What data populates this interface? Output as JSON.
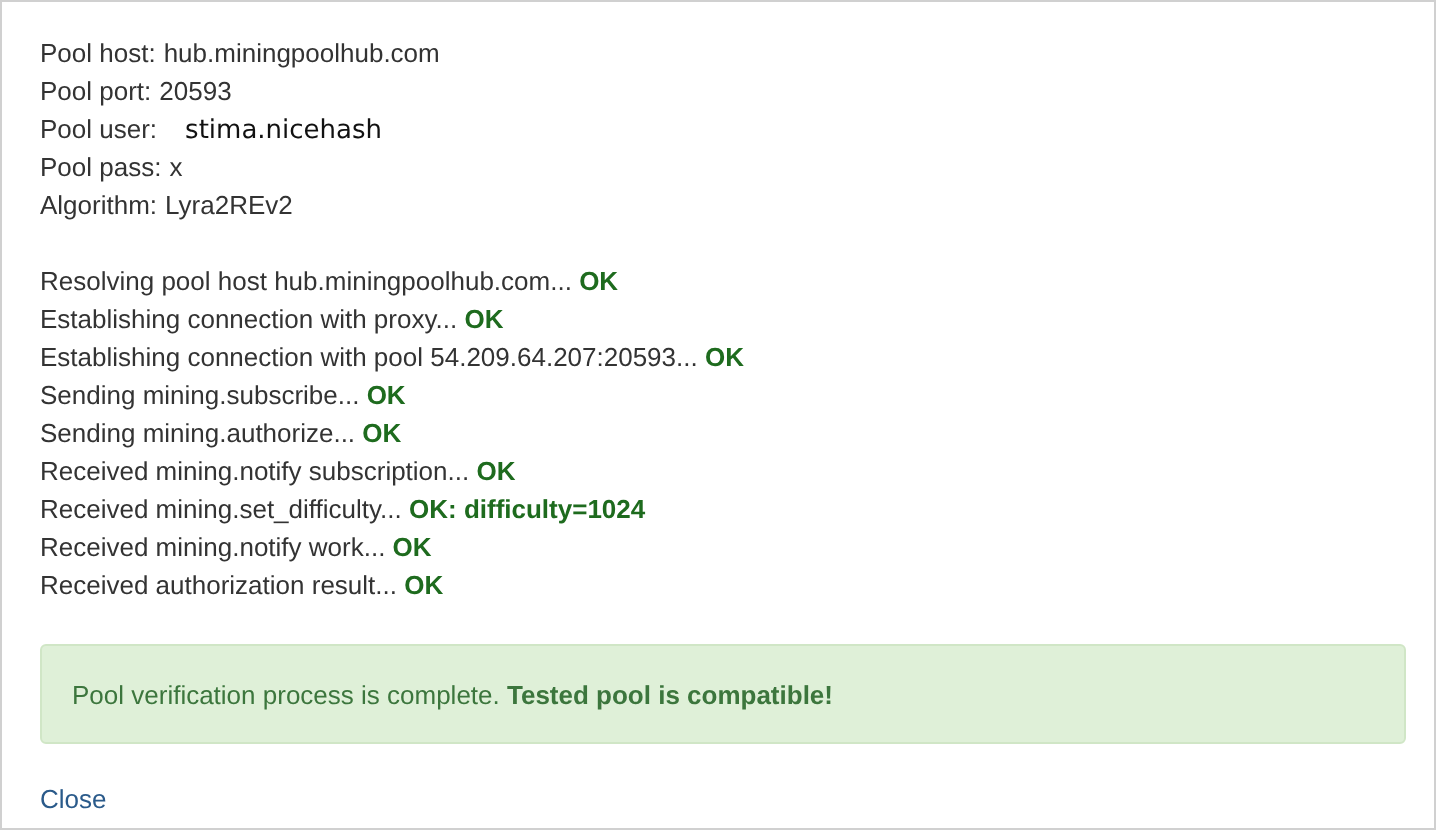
{
  "pool_info": [
    {
      "label": "Pool host:",
      "value": "hub.miningpoolhub.com",
      "kind": "plain"
    },
    {
      "label": "Pool port:",
      "value": "20593",
      "kind": "plain"
    },
    {
      "label": "Pool user:",
      "value": "stima.nicehash",
      "kind": "typed"
    },
    {
      "label": "Pool pass:",
      "value": "x",
      "kind": "plain"
    },
    {
      "label": "Algorithm:",
      "value": "Lyra2REv2",
      "kind": "plain"
    }
  ],
  "log": [
    "Resolving pool host hub.miningpoolhub.com... **OK**",
    "Establishing connection with proxy... **OK**",
    "Establishing connection with pool 54.209.64.207:20593... **OK**",
    "Sending mining.subscribe... **OK**",
    "Sending mining.authorize... **OK**",
    "Received mining.notify subscription... **OK**",
    "Received mining.set_difficulty... **OK: difficulty=1024**",
    "Received mining.notify work... **OK**",
    "Received authorization result... **OK**"
  ],
  "alert": {
    "kind": "success",
    "text": "Pool verification process is complete. **Tested pool is compatible!**"
  },
  "close_link": "Close"
}
